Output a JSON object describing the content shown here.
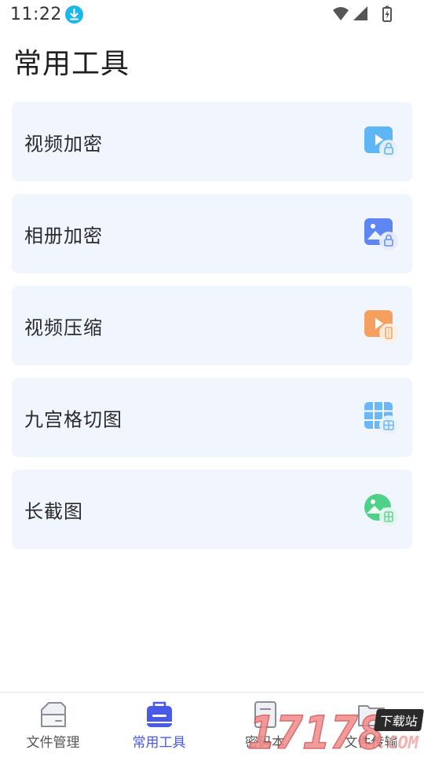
{
  "status": {
    "time": "11:22"
  },
  "page": {
    "title": "常用工具"
  },
  "tools": [
    {
      "label": "视频加密",
      "icon": "video-lock-icon",
      "color": "#5fb6f5"
    },
    {
      "label": "相册加密",
      "icon": "album-lock-icon",
      "color": "#5f86f5"
    },
    {
      "label": "视频压缩",
      "icon": "video-compress-icon",
      "color": "#f5a05f"
    },
    {
      "label": "九宫格切图",
      "icon": "grid-cut-icon",
      "color": "#6ab8f7"
    },
    {
      "label": "长截图",
      "icon": "long-screenshot-icon",
      "color": "#4fd18a"
    }
  ],
  "nav": {
    "items": [
      {
        "label": "文件管理",
        "active": false
      },
      {
        "label": "常用工具",
        "active": true
      },
      {
        "label": "密码本",
        "active": false
      },
      {
        "label": "文件传输",
        "active": false
      }
    ],
    "active_color": "#4a5ae8"
  },
  "watermark": {
    "text": "17178",
    "suffix": ".COM",
    "tag": "下载站"
  }
}
